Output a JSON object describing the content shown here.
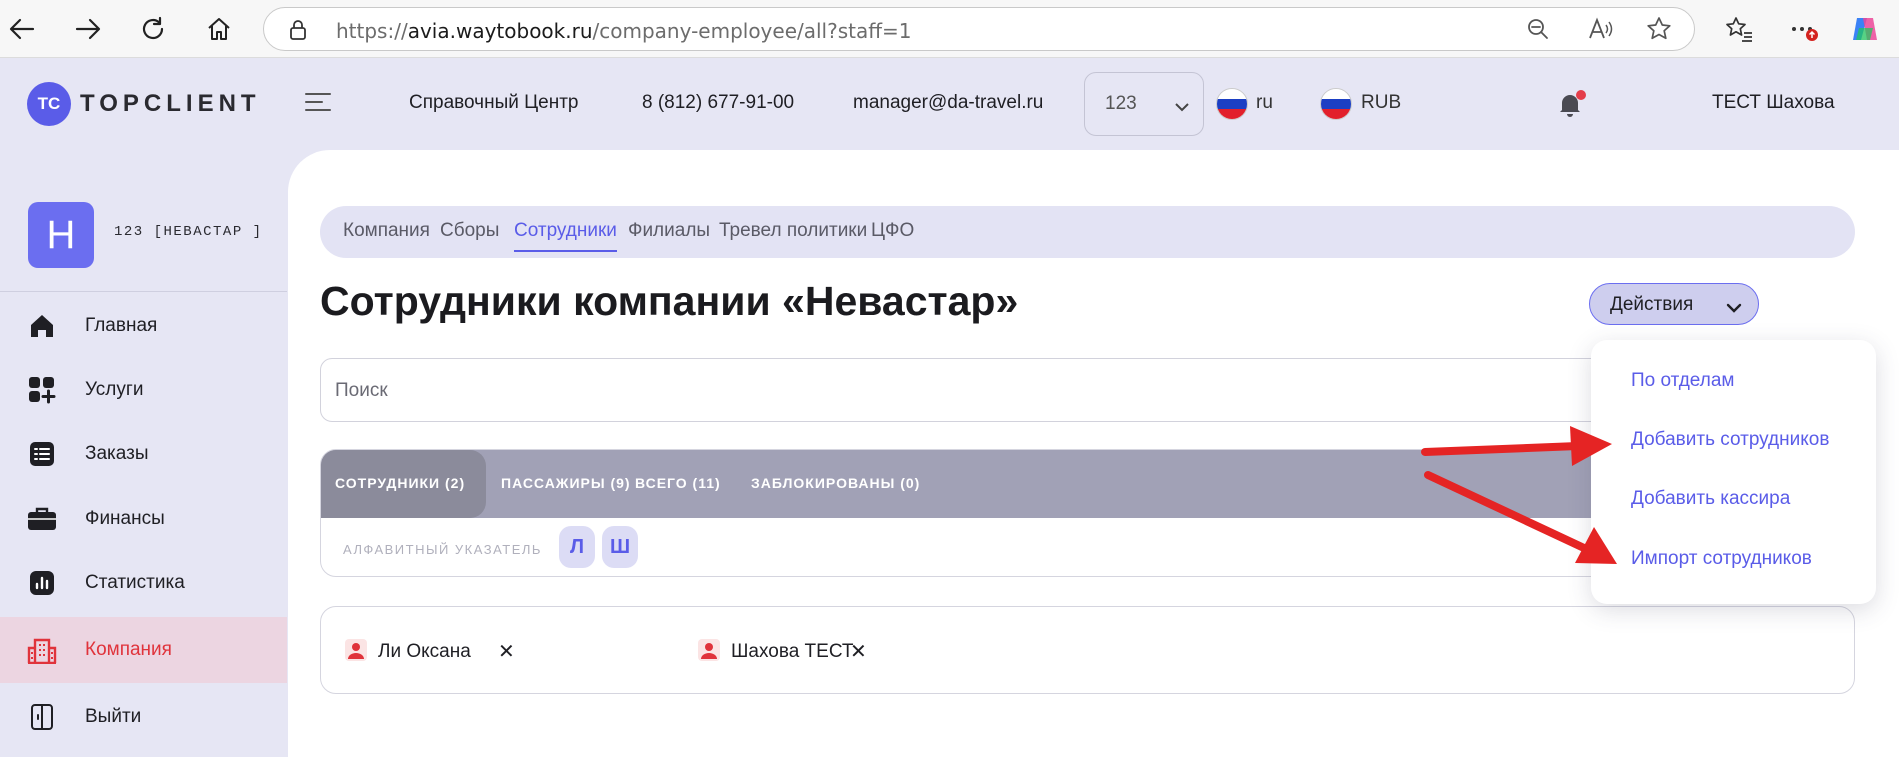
{
  "browser": {
    "url_scheme": "https://",
    "url_host": "avia.waytobook.ru",
    "url_path": "/company-employee/all?staff=1"
  },
  "header": {
    "logo_badge": "TC",
    "logo_text": "TOPCLIENT",
    "help_center": "Справочный Центр",
    "phone": "8 (812) 677-91-00",
    "email": "manager@da-travel.ru",
    "account_select": "123",
    "language": "ru",
    "currency": "RUB",
    "user_name": "ТЕСТ Шахова"
  },
  "sidebar": {
    "org_initial": "Н",
    "org_name": "123 [НЕВАСТАР ]",
    "items": [
      {
        "label": "Главная",
        "icon": "home-icon"
      },
      {
        "label": "Услуги",
        "icon": "services-grid-icon"
      },
      {
        "label": "Заказы",
        "icon": "orders-list-icon"
      },
      {
        "label": "Финансы",
        "icon": "briefcase-icon"
      },
      {
        "label": "Статистика",
        "icon": "statistics-chart-icon"
      },
      {
        "label": "Компания",
        "icon": "building-icon",
        "active": true
      },
      {
        "label": "Выйти",
        "icon": "logout-door-icon"
      }
    ]
  },
  "main": {
    "tabs": [
      {
        "label": "Компания"
      },
      {
        "label": "Сборы"
      },
      {
        "label": "Сотрудники",
        "active": true
      },
      {
        "label": "Филиалы"
      },
      {
        "label": "Тревел политики"
      },
      {
        "label": "ЦФО"
      }
    ],
    "title": "Сотрудники компании «Невастар»",
    "actions_label": "Действия",
    "search_placeholder": "Поиск",
    "filter_tabs": [
      {
        "label": "СОТРУДНИКИ (2)",
        "active": true
      },
      {
        "label": "ПАССАЖИРЫ (9)"
      },
      {
        "label": "ВСЕГО (11)"
      },
      {
        "label": "ЗАБЛОКИРОВАНЫ (0)"
      }
    ],
    "alphabet_label": "АЛФАВИТНЫЙ УКАЗАТЕЛЬ",
    "alphabet_letters": [
      "Л",
      "Ш"
    ],
    "employees": [
      {
        "name": "Ли Оксана"
      },
      {
        "name": "Шахова ТЕСТ"
      }
    ],
    "remove_symbol": "✕"
  },
  "actions_menu": {
    "items": [
      {
        "label": "По отделам"
      },
      {
        "label": "Добавить сотрудников"
      },
      {
        "label": "Добавить кассира"
      },
      {
        "label": "Импорт сотрудников"
      }
    ]
  },
  "colors": {
    "accent": "#5a5ce8",
    "active_nav": "#e0333b",
    "annotation_arrow": "#e52424"
  }
}
